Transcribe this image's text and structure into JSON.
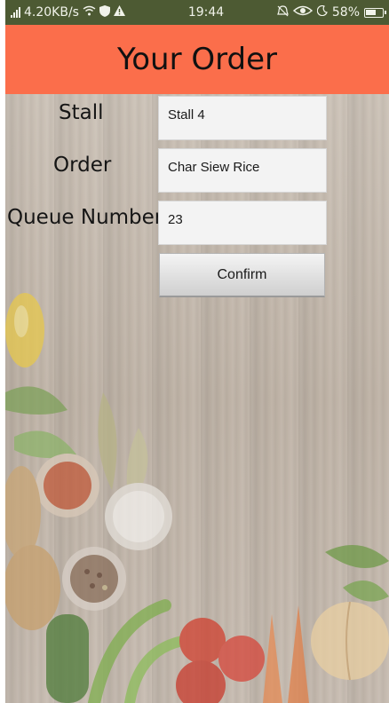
{
  "status_bar": {
    "network_speed": "4.20KB/s",
    "time": "19:44",
    "battery_percent": "58%"
  },
  "header": {
    "title": "Your Order"
  },
  "form": {
    "stall_label": "Stall",
    "stall_value": "Stall 4",
    "order_label": "Order",
    "order_value": "Char Siew Rice",
    "queue_label": "Queue Number",
    "queue_value": "23",
    "confirm_label": "Confirm"
  },
  "colors": {
    "header_bg": "#fb6e4b",
    "status_bg": "#4d5a33"
  }
}
